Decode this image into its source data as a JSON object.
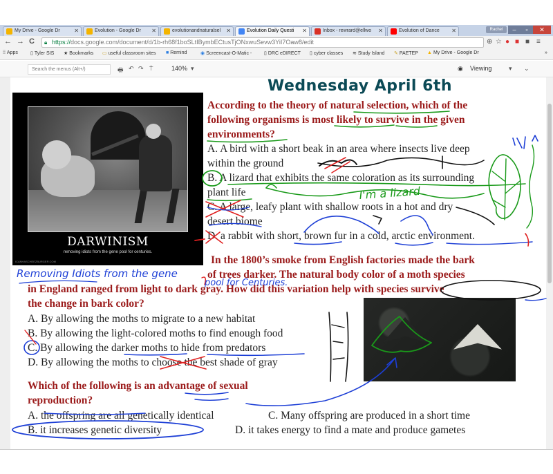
{
  "browser": {
    "tabs": [
      {
        "label": "My Drive - Google Dr",
        "favicon_color": "#f4b400"
      },
      {
        "label": "Evolution - Google Dr",
        "favicon_color": "#f4b400"
      },
      {
        "label": "evolutionandnaturalsel",
        "favicon_color": "#f4b400"
      },
      {
        "label": "Evolution Daily Questi",
        "favicon_color": "#4285f4",
        "active": true
      },
      {
        "label": "Inbox - rewrard@ellwo",
        "favicon_color": "#d93025"
      },
      {
        "label": "Evolution of Dance",
        "favicon_color": "#ff0000"
      }
    ],
    "user_name": "Rachel",
    "url_scheme": "https://",
    "url_rest": "docs.google.com/document/d/1b-rh68f1boSLtIBymbECtusTjONxwuSevw3YiI7Oaw8/edit",
    "bookmarks": [
      {
        "icon": "apps-icon",
        "label": "Apps"
      },
      {
        "icon": "page-icon",
        "label": "Tyler SIS"
      },
      {
        "icon": "star-icon",
        "label": "Bookmarks"
      },
      {
        "icon": "folder-icon",
        "label": "useful classroom sites"
      },
      {
        "icon": "remind-icon",
        "label": "Remind"
      },
      {
        "icon": "screencast-icon",
        "label": "Screencast-O-Matic -"
      },
      {
        "icon": "page-icon",
        "label": "DRC eDIRECT"
      },
      {
        "icon": "page-icon",
        "label": "cyber classes"
      },
      {
        "icon": "island-icon",
        "label": "Study Island"
      },
      {
        "icon": "pencil-icon",
        "label": "PAETEP"
      },
      {
        "icon": "drive-icon",
        "label": "My Drive - Google Dr"
      }
    ]
  },
  "docs_toolbar": {
    "menu_search_placeholder": "Search the menus (Alt+/)",
    "zoom": "140%",
    "mode": "Viewing"
  },
  "document": {
    "date": "Wednesday April 6th",
    "poster": {
      "title": "DARWINISM",
      "caption": "removing idiots from the gene pool for centuries.",
      "watermark": "ICANHASCHEEZBURGER.COM"
    },
    "q1": {
      "line1": "According to the theory of natural selection, which of the",
      "line2": "following organisms is most likely to survive in the given",
      "line3": "environments?",
      "a1": "A.  A bird with a short beak in an area where insects live deep",
      "a2": "within the ground",
      "b1": "B.  A lizard that exhibits the same coloration as its surrounding",
      "b2": "plant life",
      "c1": "C. A large, leafy plant with shallow roots in a hot and dry",
      "c2": "desert biome",
      "d1": "D. a rabbit with short, brown fur in a cold, arctic environment."
    },
    "q2": {
      "line1": "In the 1800’s smoke from English factories made the bark",
      "line2": "of trees darker.  The natural body color of a moth species",
      "line3": "in England ranged from light to dark gray.  How did this variation help with species survive",
      "line4": "the change in bark color?",
      "a": "A. By allowing the moths to migrate to a new habitat",
      "b": "B. By allowing the light-colored moths to find enough food",
      "c": "C. By allowing the darker moths to hide from predators",
      "d": "D. By allowing the moths to choose the best shade of gray"
    },
    "q3": {
      "line1": "Which of the following is an advantage of sexual",
      "line2": "reproduction?",
      "a": "A.  the offspring are all genetically identical",
      "b": "B.  it increases genetic diversity",
      "c": "C.  Many offspring are produced in a short time",
      "d": "D.  it takes energy to find a mate and produce gametes"
    },
    "annotations": {
      "lizard_note": "I'm a lizard",
      "removing_line1": "Removing Idiots from the gene",
      "removing_line2": "pool for Centuries."
    }
  },
  "colors": {
    "question_red": "#9b1b1b",
    "date_teal": "#0c4a56",
    "ink_green": "#1a9a1a",
    "ink_blue": "#1d3fd6",
    "ink_red": "#e02020"
  }
}
